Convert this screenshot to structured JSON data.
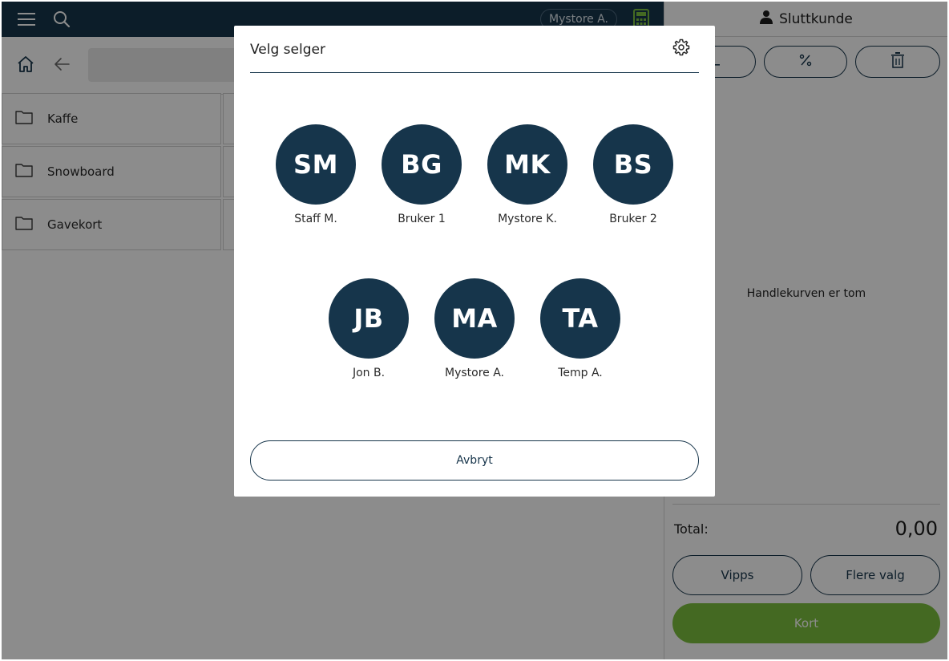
{
  "topbar": {
    "menu_icon": "hamburger-icon",
    "search_icon": "search-icon",
    "current_user": "Mystore A.",
    "calculator_icon": "calculator-icon"
  },
  "nav": {
    "home_icon": "home-icon",
    "back_icon": "arrow-left-icon"
  },
  "categories": [
    {
      "label": "Kaffe",
      "icon": "folder-icon"
    },
    {
      "label": "Snowboard",
      "icon": "folder-icon"
    },
    {
      "label": "Gavekort",
      "icon": "folder-icon"
    }
  ],
  "cart": {
    "customer_label": "Sluttkunde",
    "customer_icon": "person-icon",
    "actions": [
      {
        "name": "minus-icon"
      },
      {
        "name": "percent-icon"
      },
      {
        "name": "trash-icon"
      }
    ],
    "empty_message": "Handlekurven er tom",
    "total_label": "Total:",
    "total_value": "0,00",
    "vipps_label": "Vipps",
    "more_label": "Flere valg",
    "card_label": "Kort"
  },
  "modal": {
    "title": "Velg selger",
    "settings_icon": "gear-icon",
    "sellers": [
      {
        "initials": "SM",
        "name": "Staff M."
      },
      {
        "initials": "BG",
        "name": "Bruker 1"
      },
      {
        "initials": "MK",
        "name": "Mystore K."
      },
      {
        "initials": "BS",
        "name": "Bruker 2"
      },
      {
        "initials": "JB",
        "name": "Jon B."
      },
      {
        "initials": "MA",
        "name": "Mystore A."
      },
      {
        "initials": "TA",
        "name": "Temp A."
      }
    ],
    "cancel_label": "Avbryt"
  },
  "colors": {
    "primary": "#17354b",
    "card_button": "#7cc03f",
    "overlay": "rgba(0,0,0,0.45)"
  }
}
